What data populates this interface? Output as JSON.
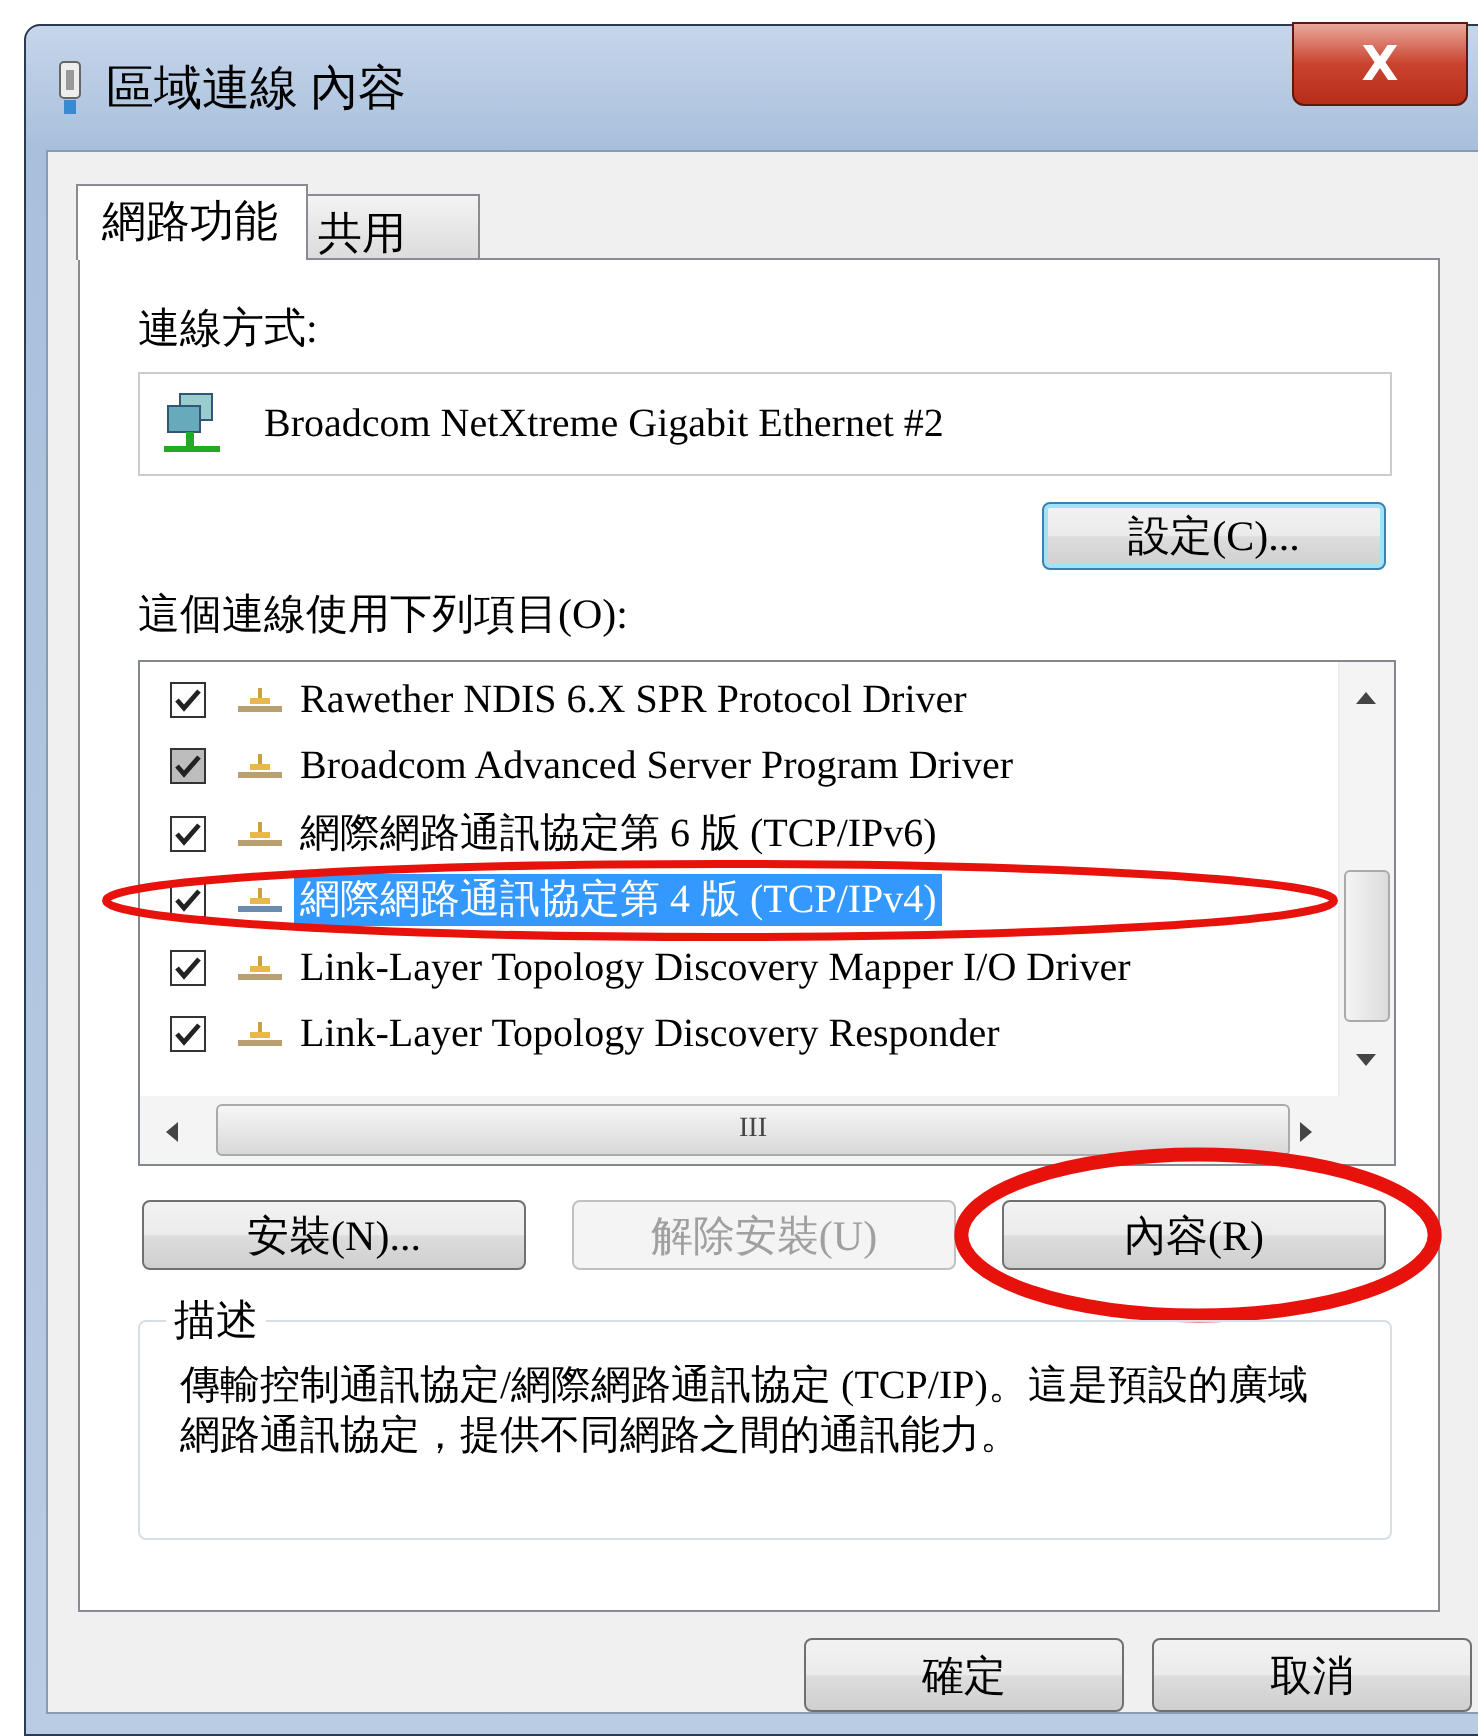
{
  "window": {
    "title": "區域連線 內容",
    "close_label": "X"
  },
  "tabs": [
    {
      "label": "網路功能",
      "selected": true
    },
    {
      "label": "共用",
      "selected": false
    }
  ],
  "connect_using": {
    "label": "連線方式:",
    "adapter": "Broadcom NetXtreme Gigabit Ethernet #2",
    "configure_button": "設定(C)..."
  },
  "items_label": "這個連線使用下列項目(O):",
  "items": [
    {
      "label": "Rawether NDIS 6.X SPR Protocol Driver",
      "checked": true,
      "disabled": false,
      "selected": false,
      "circled": false
    },
    {
      "label": "Broadcom Advanced Server Program Driver",
      "checked": true,
      "disabled": true,
      "selected": false,
      "circled": false
    },
    {
      "label": "網際網路通訊協定第 6 版 (TCP/IPv6)",
      "checked": true,
      "disabled": false,
      "selected": false,
      "circled": false
    },
    {
      "label": "網際網路通訊協定第 4 版 (TCP/IPv4)",
      "checked": true,
      "disabled": false,
      "selected": true,
      "circled": true
    },
    {
      "label": "Link-Layer Topology Discovery Mapper I/O Driver",
      "checked": true,
      "disabled": false,
      "selected": false,
      "circled": false
    },
    {
      "label": "Link-Layer Topology Discovery Responder",
      "checked": true,
      "disabled": false,
      "selected": false,
      "circled": false
    }
  ],
  "scroll_mark": "III",
  "item_buttons": [
    {
      "label": "安裝(N)...",
      "disabled": false,
      "circled": false
    },
    {
      "label": "解除安裝(U)",
      "disabled": true,
      "circled": false
    },
    {
      "label": "內容(R)",
      "disabled": false,
      "circled": true
    }
  ],
  "description": {
    "legend": "描述",
    "text": "傳輸控制通訊協定/網際網路通訊協定 (TCP/IP)。這是預設的廣域網路通訊協定，提供不同網路之間的通訊能力。"
  },
  "dialog_buttons": [
    "確定",
    "取消"
  ]
}
